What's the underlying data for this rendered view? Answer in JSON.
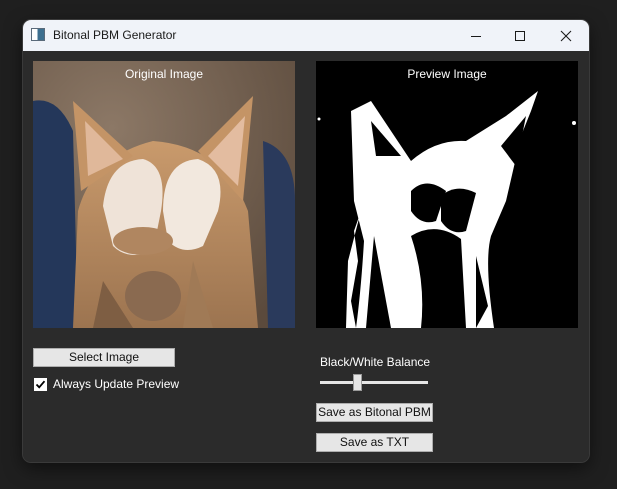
{
  "window": {
    "title": "Bitonal PBM Generator",
    "app_icon": "image-window-icon",
    "controls": [
      "minimize-icon",
      "maximize-icon",
      "close-icon"
    ]
  },
  "panels": {
    "original_label": "Original Image",
    "preview_label": "Preview Image"
  },
  "controls": {
    "select_image_label": "Select Image",
    "always_update_label": "Always Update Preview",
    "always_update_checked": true,
    "balance_label": "Black/White Balance",
    "balance_value": 0.33,
    "save_pbm_label": "Save as Bitonal PBM",
    "save_txt_label": "Save as TXT"
  },
  "colors": {
    "titlebar_bg": "#f0f3f9",
    "window_bg": "#2b2b2b",
    "button_bg": "#e6e6e6",
    "text_light": "#ffffff"
  }
}
